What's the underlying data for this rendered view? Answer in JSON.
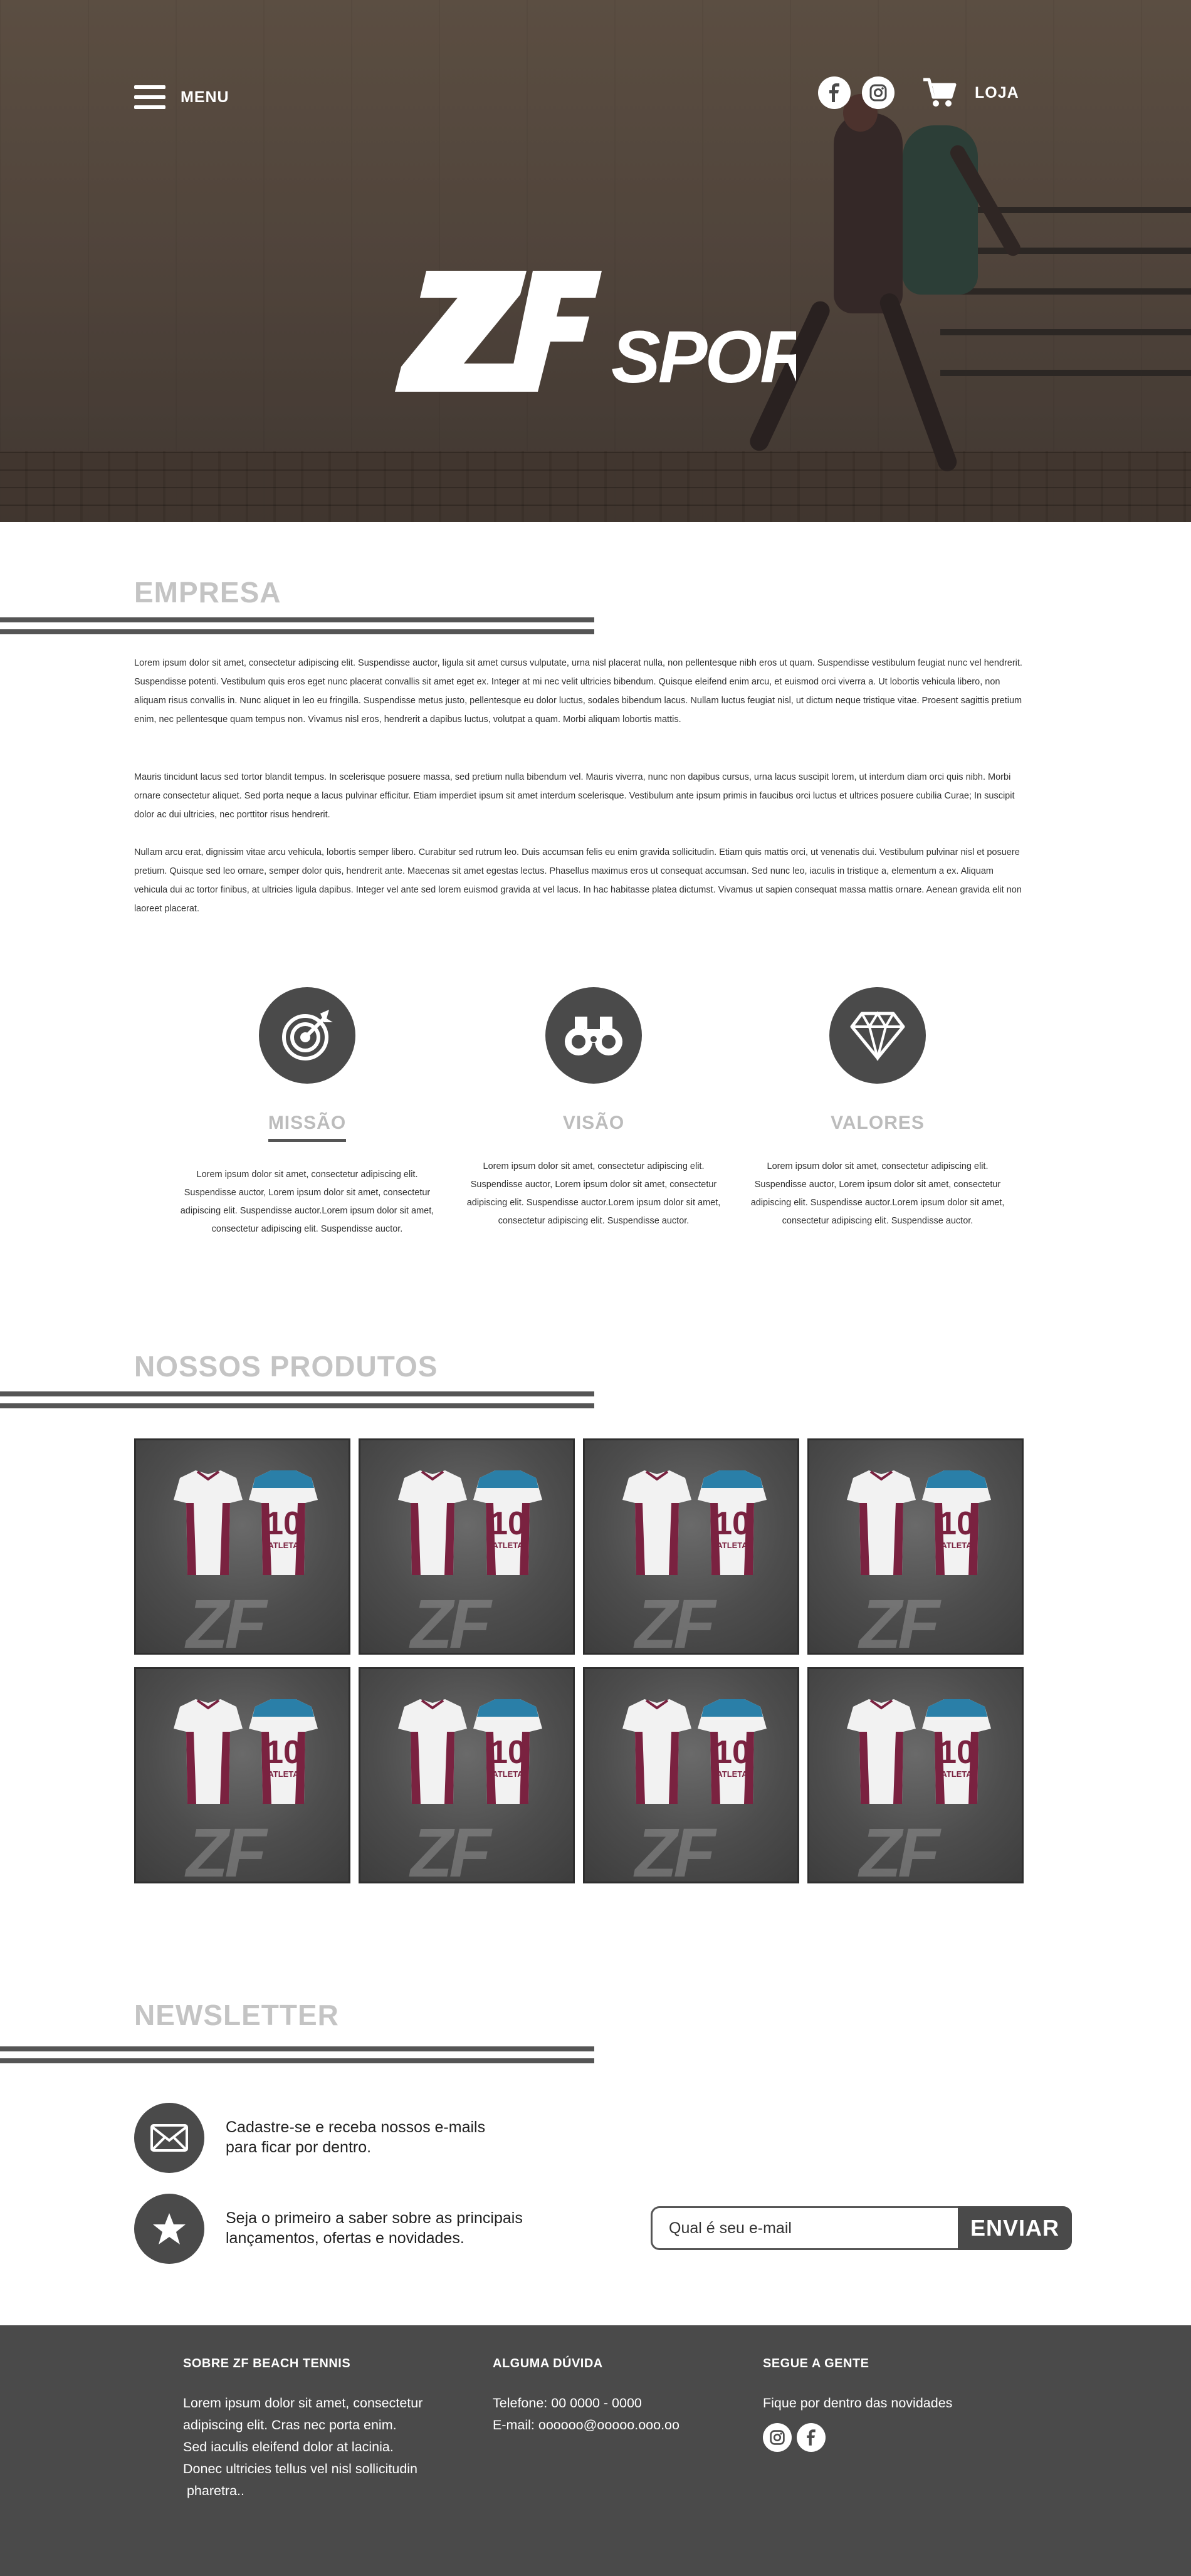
{
  "header": {
    "menu_label": "MENU",
    "shop_label": "LOJA",
    "social_icons": [
      "facebook-icon",
      "instagram-icon"
    ],
    "cart_icon": "cart-icon"
  },
  "logo": {
    "mark": "ZF",
    "word": "SPORT"
  },
  "empresa": {
    "title": "EMPRESA",
    "paragraphs": [
      "Lorem ipsum dolor sit amet, consectetur adipiscing elit. Suspendisse auctor, ligula sit amet cursus vulputate, urna nisl placerat nulla, non pellentesque nibh eros ut quam. Suspendisse vestibulum feugiat nunc vel hendrerit. Suspendisse potenti. Vestibulum quis eros eget nunc placerat convallis sit amet eget ex. Integer at mi nec velit ultricies bibendum. Quisque eleifend enim arcu, et euismod orci viverra a. Ut lobortis vehicula libero, non aliquam risus convallis in. Nunc aliquet in leo eu fringilla. Suspendisse metus justo, pellentesque eu dolor luctus, sodales bibendum lacus. Nullam luctus feugiat nisl, ut dictum neque tristique vitae. Proesent sagittis pretium enim, nec pellentesque quam tempus non. Vivamus nisl eros, hendrerit a dapibus luctus, volutpat a quam. Morbi aliquam lobortis mattis.",
      "Mauris tincidunt lacus sed tortor blandit tempus. In scelerisque posuere massa, sed pretium nulla bibendum vel. Mauris viverra, nunc non dapibus cursus, urna lacus suscipit lorem, ut interdum diam orci quis nibh. Morbi ornare consectetur aliquet. Sed porta neque a lacus pulvinar efficitur. Etiam imperdiet ipsum sit amet interdum scelerisque. Vestibulum ante ipsum primis in faucibus orci luctus et ultrices posuere cubilia Curae; In suscipit dolor ac dui ultricies, nec porttitor risus hendrerit.",
      "Nullam arcu erat, dignissim vitae arcu vehicula, lobortis semper libero. Curabitur sed rutrum leo. Duis accumsan felis eu enim gravida sollicitudin. Etiam quis mattis orci, ut venenatis dui. Vestibulum pulvinar nisl et posuere pretium. Quisque sed leo ornare, semper dolor quis, hendrerit ante. Maecenas sit amet egestas lectus. Phasellus maximus eros ut consequat accumsan. Sed nunc leo, iaculis in tristique a, elementum a ex. Aliquam vehicula dui ac tortor finibus, at ultricies ligula dapibus. Integer vel ante sed lorem euismod gravida at vel lacus. In hac habitasse platea dictumst. Vivamus ut sapien consequat massa mattis ornare. Aenean gravida elit non laoreet placerat."
    ]
  },
  "features": [
    {
      "title": "MISSÃO",
      "icon": "target-icon",
      "text": "Lorem ipsum dolor sit amet, consectetur adipiscing elit. Suspendisse auctor, Lorem ipsum dolor sit amet, consectetur adipiscing elit. Suspendisse auctor.Lorem ipsum dolor sit amet, consectetur adipiscing elit. Suspendisse auctor."
    },
    {
      "title": "VISÃO",
      "icon": "binoculars-icon",
      "text": "Lorem ipsum dolor sit amet, consectetur adipiscing elit. Suspendisse auctor, Lorem ipsum dolor sit amet, consectetur adipiscing elit. Suspendisse auctor.Lorem ipsum dolor sit amet, consectetur adipiscing elit. Suspendisse auctor."
    },
    {
      "title": "VALORES",
      "icon": "diamond-icon",
      "text": "Lorem ipsum dolor sit amet, consectetur adipiscing elit. Suspendisse auctor, Lorem ipsum dolor sit amet, consectetur adipiscing elit. Suspendisse auctor.Lorem ipsum dolor sit amet, consectetur adipiscing elit. Suspendisse auctor."
    }
  ],
  "produtos": {
    "title": "NOSSOS PRODUTOS",
    "items": [
      {
        "number": "10",
        "name": "ATLETA",
        "watermark": "ZF"
      },
      {
        "number": "10",
        "name": "ATLETA",
        "watermark": "ZF"
      },
      {
        "number": "10",
        "name": "ATLETA",
        "watermark": "ZF"
      },
      {
        "number": "10",
        "name": "ATLETA",
        "watermark": "ZF"
      },
      {
        "number": "10",
        "name": "ATLETA",
        "watermark": "ZF"
      },
      {
        "number": "10",
        "name": "ATLETA",
        "watermark": "ZF"
      },
      {
        "number": "10",
        "name": "ATLETA",
        "watermark": "ZF"
      },
      {
        "number": "10",
        "name": "ATLETA",
        "watermark": "ZF"
      }
    ]
  },
  "newsletter": {
    "title": "NEWSLETTER",
    "line1a": "Cadastre-se e receba nossos e-mails",
    "line1b": "para ficar por dentro.",
    "line2a": "Seja o primeiro a saber sobre as principais",
    "line2b": "lançamentos, ofertas e novidades.",
    "email_placeholder": "Qual é seu e-mail",
    "send_label": "ENVIAR"
  },
  "footer": {
    "about_title": "SOBRE ZF BEACH TENNIS",
    "about_lines": [
      "Lorem ipsum dolor sit amet, consectetur",
      "adipiscing elit. Cras nec porta enim.",
      "Sed iaculis eleifend dolor at lacinia.",
      "Donec ultricies tellus vel nisl sollicitudin",
      " pharetra.."
    ],
    "help_title": "ALGUMA DÚVIDA",
    "phone": "Telefone: 00 0000 - 0000",
    "email": "E-mail: oooooo@ooooo.ooo.oo",
    "follow_title": "SEGUE A GENTE",
    "follow_text": "Fique por dentro das novidades"
  },
  "colors": {
    "dark": "#4a4a4a",
    "title_gray": "#c4c4c4",
    "jersey_maroon": "#7a2240",
    "jersey_blue": "#2a7fa8"
  }
}
